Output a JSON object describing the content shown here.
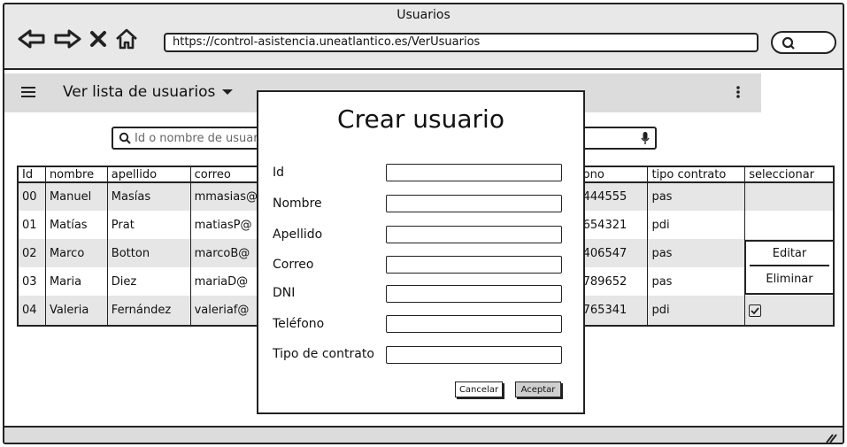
{
  "window": {
    "title": "Usuarios"
  },
  "browser": {
    "url": "https://control-asistencia.uneatlantico.es/VerUsuarios",
    "icons": [
      "back-arrow-icon",
      "forward-arrow-icon",
      "close-icon",
      "home-icon",
      "search-icon"
    ]
  },
  "toolbar": {
    "view_title": "Ver lista de usuarios"
  },
  "search": {
    "placeholder": "Id o nombre de usuario"
  },
  "table": {
    "columns": [
      "Id",
      "nombre",
      "apellido",
      "correo",
      "",
      "ono",
      "tipo contrato",
      "seleccionar"
    ],
    "rows": [
      {
        "id": "00",
        "nombre": "Manuel",
        "apellido": "Masías",
        "correo": "mmasias@",
        "telefono": "444555",
        "tipo": "pas"
      },
      {
        "id": "01",
        "nombre": "Matías",
        "apellido": "Prat",
        "correo": "matiasP@",
        "telefono": "654321",
        "tipo": "pdi"
      },
      {
        "id": "02",
        "nombre": "Marco",
        "apellido": "Botton",
        "correo": "marcoB@",
        "telefono": "406547",
        "tipo": "pas"
      },
      {
        "id": "03",
        "nombre": "Maria",
        "apellido": "Diez",
        "correo": "mariaD@",
        "telefono": "789652",
        "tipo": "pas"
      },
      {
        "id": "04",
        "nombre": "Valeria",
        "apellido": "Fernández",
        "correo": "valeriaf@",
        "telefono": "765341",
        "tipo": "pdi"
      }
    ]
  },
  "context_menu": {
    "edit": "Editar",
    "delete": "Eliminar"
  },
  "modal": {
    "title": "Crear usuario",
    "fields": [
      {
        "label": "Id",
        "value": ""
      },
      {
        "label": "Nombre",
        "value": ""
      },
      {
        "label": "Apellido",
        "value": ""
      },
      {
        "label": "Correo",
        "value": ""
      },
      {
        "label": "DNI",
        "value": ""
      },
      {
        "label": "Teléfono",
        "value": ""
      },
      {
        "label": "Tipo de contrato",
        "value": ""
      }
    ],
    "cancel_label": "Cancelar",
    "accept_label": "Aceptar"
  }
}
